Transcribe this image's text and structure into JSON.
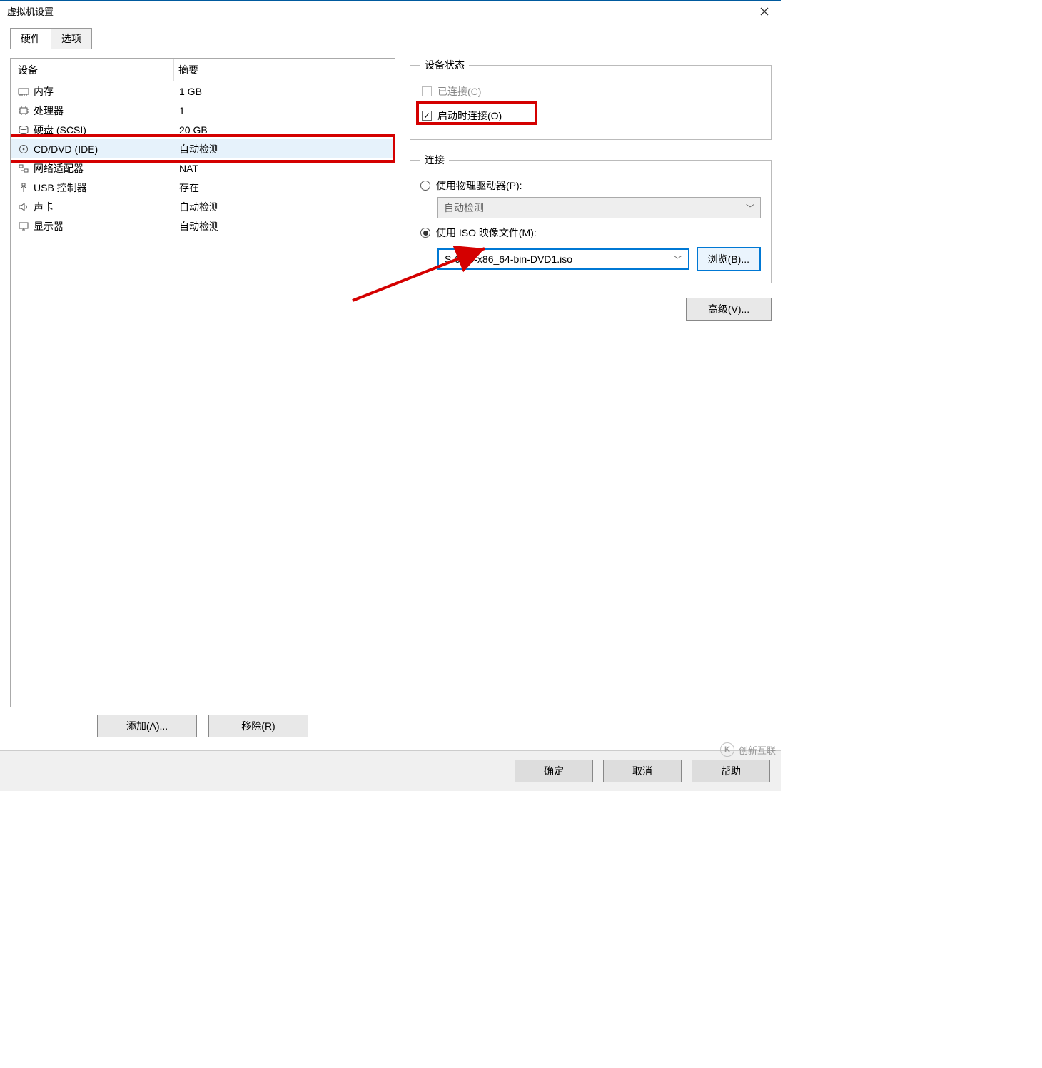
{
  "window": {
    "title": "虚拟机设置"
  },
  "tabs": {
    "hardware": "硬件",
    "options": "选项"
  },
  "device_list": {
    "header_device": "设备",
    "header_summary": "摘要",
    "rows": [
      {
        "name": "内存",
        "summary": "1 GB",
        "icon": "memory"
      },
      {
        "name": "处理器",
        "summary": "1",
        "icon": "cpu"
      },
      {
        "name": "硬盘 (SCSI)",
        "summary": "20 GB",
        "icon": "disk"
      },
      {
        "name": "CD/DVD (IDE)",
        "summary": "自动检测",
        "icon": "cd",
        "selected": true
      },
      {
        "name": "网络适配器",
        "summary": "NAT",
        "icon": "net"
      },
      {
        "name": "USB 控制器",
        "summary": "存在",
        "icon": "usb"
      },
      {
        "name": "声卡",
        "summary": "自动检测",
        "icon": "sound"
      },
      {
        "name": "显示器",
        "summary": "自动检测",
        "icon": "display"
      }
    ]
  },
  "device_status": {
    "legend": "设备状态",
    "connected_label": "已连接(C)",
    "connect_at_poweron_label": "启动时连接(O)"
  },
  "connection": {
    "legend": "连接",
    "use_physical_label": "使用物理驱动器(P):",
    "physical_value": "自动检测",
    "use_iso_label": "使用 ISO 映像文件(M):",
    "iso_value": "S-6.10-x86_64-bin-DVD1.iso",
    "browse_label": "浏览(B)..."
  },
  "advanced_btn": "高级(V)...",
  "add_btn": "添加(A)...",
  "remove_btn": "移除(R)",
  "footer": {
    "ok": "确定",
    "cancel": "取消",
    "help": "帮助"
  },
  "watermark": "创新互联"
}
